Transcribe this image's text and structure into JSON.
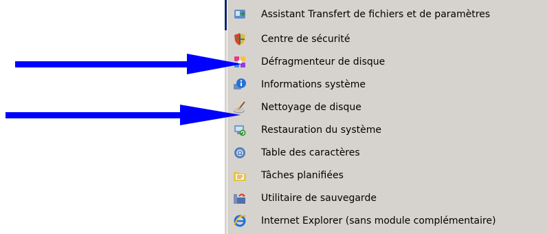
{
  "menu": {
    "items": [
      {
        "label": "Assistant Transfert de fichiers et de paramètres",
        "icon": "transfer-wizard-icon"
      },
      {
        "label": "Centre de sécurité",
        "icon": "security-shield-icon"
      },
      {
        "label": "Défragmenteur de disque",
        "icon": "defragmenter-icon"
      },
      {
        "label": "Informations système",
        "icon": "system-info-icon"
      },
      {
        "label": "Nettoyage de disque",
        "icon": "disk-cleanup-icon"
      },
      {
        "label": "Restauration du système",
        "icon": "system-restore-icon"
      },
      {
        "label": "Table des caractères",
        "icon": "character-map-icon"
      },
      {
        "label": "Tâches planifiées",
        "icon": "scheduled-tasks-icon"
      },
      {
        "label": "Utilitaire de sauvegarde",
        "icon": "backup-utility-icon"
      },
      {
        "label": "Internet Explorer (sans module complémentaire)",
        "icon": "internet-explorer-icon"
      }
    ]
  },
  "annotations": {
    "arrow_color": "#0000ff",
    "arrows": [
      {
        "points_to": "Défragmenteur de disque"
      },
      {
        "points_to": "Nettoyage de disque"
      }
    ]
  }
}
